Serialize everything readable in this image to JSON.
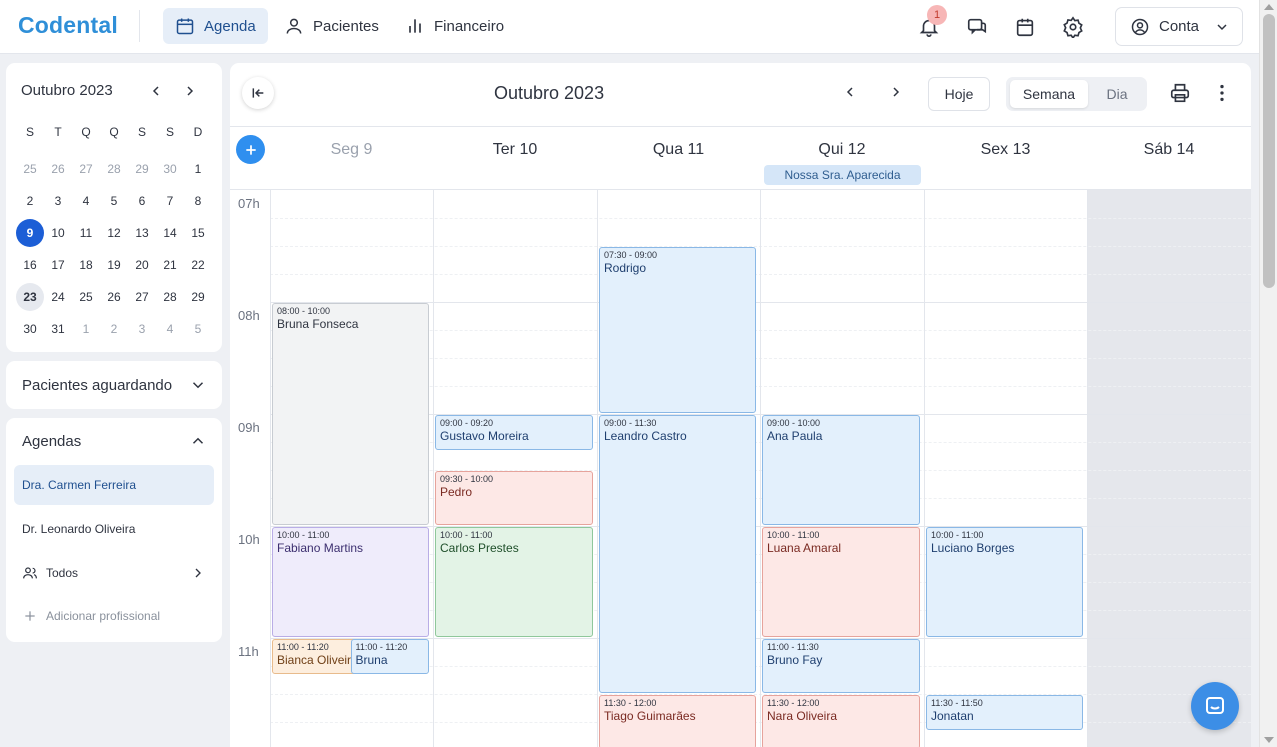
{
  "app": {
    "logo": "Codental"
  },
  "nav": {
    "agenda": "Agenda",
    "pacientes": "Pacientes",
    "financeiro": "Financeiro"
  },
  "notifications": {
    "count": "1"
  },
  "account": {
    "label": "Conta"
  },
  "mini_calendar": {
    "title": "Outubro 2023",
    "weekdays": [
      "S",
      "T",
      "Q",
      "Q",
      "S",
      "S",
      "D"
    ],
    "days": [
      {
        "d": "25",
        "m": true
      },
      {
        "d": "26",
        "m": true
      },
      {
        "d": "27",
        "m": true
      },
      {
        "d": "28",
        "m": true
      },
      {
        "d": "29",
        "m": true
      },
      {
        "d": "30",
        "m": true
      },
      {
        "d": "1"
      },
      {
        "d": "2"
      },
      {
        "d": "3"
      },
      {
        "d": "4"
      },
      {
        "d": "5"
      },
      {
        "d": "6"
      },
      {
        "d": "7"
      },
      {
        "d": "8"
      },
      {
        "d": "9",
        "sel": true
      },
      {
        "d": "10"
      },
      {
        "d": "11"
      },
      {
        "d": "12"
      },
      {
        "d": "13"
      },
      {
        "d": "14"
      },
      {
        "d": "15"
      },
      {
        "d": "16"
      },
      {
        "d": "17"
      },
      {
        "d": "18"
      },
      {
        "d": "19"
      },
      {
        "d": "20"
      },
      {
        "d": "21"
      },
      {
        "d": "22"
      },
      {
        "d": "23",
        "today": true
      },
      {
        "d": "24"
      },
      {
        "d": "25"
      },
      {
        "d": "26"
      },
      {
        "d": "27"
      },
      {
        "d": "28"
      },
      {
        "d": "29"
      },
      {
        "d": "30"
      },
      {
        "d": "31"
      },
      {
        "d": "1",
        "m": true
      },
      {
        "d": "2",
        "m": true
      },
      {
        "d": "3",
        "m": true
      },
      {
        "d": "4",
        "m": true
      },
      {
        "d": "5",
        "m": true
      }
    ]
  },
  "waiting": {
    "title": "Pacientes aguardando"
  },
  "agendas": {
    "title": "Agendas",
    "professionals": [
      "Dra. Carmen Ferreira",
      "Dr. Leonardo Oliveira"
    ],
    "all_label": "Todos",
    "add_label": "Adicionar profissional"
  },
  "calendar": {
    "title": "Outubro 2023",
    "today_label": "Hoje",
    "view_week": "Semana",
    "view_day": "Dia",
    "days": [
      "Seg 9",
      "Ter 10",
      "Qua 11",
      "Qui 12",
      "Sex 13",
      "Sáb 14"
    ],
    "holiday": "Nossa Sra. Aparecida",
    "hours": [
      "07h",
      "08h",
      "09h",
      "10h",
      "11h"
    ],
    "events": [
      {
        "day": 0,
        "start": "08:00",
        "end": "10:00",
        "time": "08:00 - 10:00",
        "name": "Bruna Fonseca",
        "color": "gray"
      },
      {
        "day": 0,
        "start": "10:00",
        "end": "11:00",
        "time": "10:00 - 11:00",
        "name": "Fabiano Martins",
        "color": "purple"
      },
      {
        "day": 0,
        "start": "11:00",
        "end": "11:20",
        "time": "11:00 - 11:20",
        "name": "Bianca Oliveira",
        "color": "orange",
        "part": 0
      },
      {
        "day": 0,
        "start": "11:00",
        "end": "11:20",
        "time": "11:00 - 11:20",
        "name": "Bruna",
        "color": "blue",
        "part": 1
      },
      {
        "day": 1,
        "start": "09:00",
        "end": "09:20",
        "time": "09:00 - 09:20",
        "name": "Gustavo Moreira",
        "color": "blue"
      },
      {
        "day": 1,
        "start": "09:30",
        "end": "10:00",
        "time": "09:30 - 10:00",
        "name": "Pedro",
        "color": "red"
      },
      {
        "day": 1,
        "start": "10:00",
        "end": "11:00",
        "time": "10:00 - 11:00",
        "name": "Carlos Prestes",
        "color": "green"
      },
      {
        "day": 2,
        "start": "07:30",
        "end": "09:00",
        "time": "07:30 - 09:00",
        "name": "Rodrigo",
        "color": "blue"
      },
      {
        "day": 2,
        "start": "09:00",
        "end": "11:30",
        "time": "09:00 - 11:30",
        "name": "Leandro Castro",
        "color": "blue"
      },
      {
        "day": 2,
        "start": "11:30",
        "end": "12:00",
        "time": "11:30 - 12:00",
        "name": "Tiago Guimarães",
        "color": "red"
      },
      {
        "day": 3,
        "start": "09:00",
        "end": "10:00",
        "time": "09:00 - 10:00",
        "name": "Ana Paula",
        "color": "blue"
      },
      {
        "day": 3,
        "start": "10:00",
        "end": "11:00",
        "time": "10:00 - 11:00",
        "name": "Luana Amaral",
        "color": "red"
      },
      {
        "day": 3,
        "start": "11:00",
        "end": "11:30",
        "time": "11:00 - 11:30",
        "name": "Bruno Fay",
        "color": "blue"
      },
      {
        "day": 3,
        "start": "11:30",
        "end": "12:00",
        "time": "11:30 - 12:00",
        "name": "Nara Oliveira",
        "color": "red"
      },
      {
        "day": 4,
        "start": "10:00",
        "end": "11:00",
        "time": "10:00 - 11:00",
        "name": "Luciano Borges",
        "color": "blue"
      },
      {
        "day": 4,
        "start": "11:30",
        "end": "11:50",
        "time": "11:30 - 11:50",
        "name": "Jonatan",
        "color": "blue"
      }
    ]
  }
}
